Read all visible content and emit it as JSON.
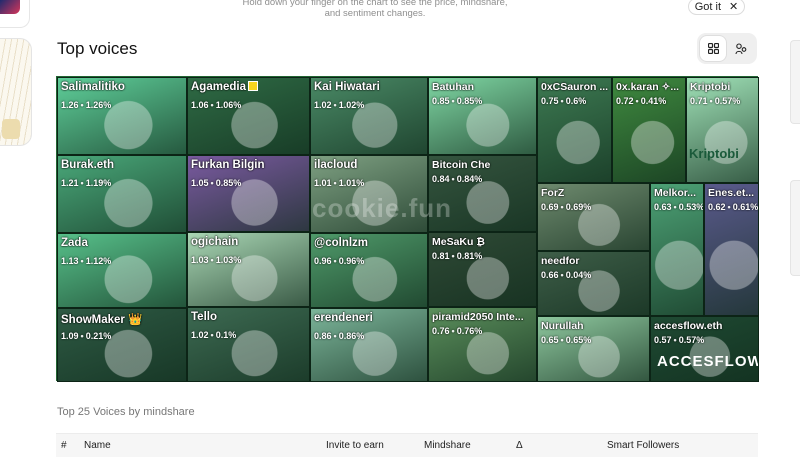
{
  "hint": {
    "line1": "Hold down your finger on the chart to see the price, mindshare,",
    "line2": "and sentiment changes."
  },
  "got_it": {
    "label": "Got it",
    "close_glyph": "✕"
  },
  "section_title": "Top voices",
  "view_toggle": {
    "grid_icon": "grid-icon",
    "people_icon": "people-icon"
  },
  "treemap": {
    "watermark": "cookie.fun",
    "tiles": [
      {
        "name": "Salimalitiko",
        "value": "1.26",
        "change": "1.26%",
        "color": "#5fcf9a"
      },
      {
        "name": "Agamedia",
        "value": "1.06",
        "change": "1.06%",
        "color": "#2f6b45",
        "badge": "yellow-square"
      },
      {
        "name": "Kai Hiwatari",
        "value": "1.02",
        "change": "1.02%",
        "color": "#4a8a66"
      },
      {
        "name": "Batuhan",
        "value": "0.85",
        "change": "0.85%",
        "color": "#7fd6a3"
      },
      {
        "name": "0xCSauron ...",
        "value": "0.75",
        "change": "0.6%",
        "color": "#3d7a52"
      },
      {
        "name": "0x.karan ✧...",
        "value": "0.72",
        "change": "0.41%",
        "color": "#3f8a3f"
      },
      {
        "name": "Kriptobi",
        "value": "0.71",
        "change": "0.57%",
        "color": "#9fe0b6",
        "logo_text": "Kriptobi"
      },
      {
        "name": "Burak.eth",
        "value": "1.21",
        "change": "1.19%",
        "color": "#4aa87a"
      },
      {
        "name": "Furkan Bilgin",
        "value": "1.05",
        "change": "0.85%",
        "color": "#7a5aa0"
      },
      {
        "name": "ilacloud",
        "value": "1.01",
        "change": "1.01%",
        "color": "#7ea082"
      },
      {
        "name": "Bitcoin Che",
        "value": "0.84",
        "change": "0.84%",
        "color": "#35553f"
      },
      {
        "name": "ForZ",
        "value": "0.69",
        "change": "0.69%",
        "color": "#6e8a6e"
      },
      {
        "name": "Melkor...",
        "value": "0.63",
        "change": "0.53%",
        "color": "#4da276"
      },
      {
        "name": "Enes.et...",
        "value": "0.62",
        "change": "0.61%",
        "color": "#5a5a8c"
      },
      {
        "name": "Zada",
        "value": "1.13",
        "change": "1.12%",
        "color": "#57c08a"
      },
      {
        "name": "ogichain",
        "value": "1.03",
        "change": "1.03%",
        "color": "#a9d6b4"
      },
      {
        "name": "@colnlzm",
        "value": "0.96",
        "change": "0.96%",
        "color": "#4f9a6a"
      },
      {
        "name": "MeSaKu ₿",
        "value": "0.81",
        "change": "0.81%",
        "color": "#2f4a36"
      },
      {
        "name": "needfor",
        "value": "0.66",
        "change": "0.04%",
        "color": "#3e5e48"
      },
      {
        "name": "ShowMaker 👑",
        "value": "1.09",
        "change": "0.21%",
        "color": "#2e5a44"
      },
      {
        "name": "Tello",
        "value": "1.02",
        "change": "0.1%",
        "color": "#3d6a52"
      },
      {
        "name": "erendeneri",
        "value": "0.86",
        "change": "0.86%",
        "color": "#7cb59a"
      },
      {
        "name": "piramid2050 Inte...",
        "value": "0.76",
        "change": "0.76%",
        "color": "#5b8f5c"
      },
      {
        "name": "Nurullah",
        "value": "0.65",
        "change": "0.65%",
        "color": "#8ec79e"
      },
      {
        "name": "accesflow.eth",
        "value": "0.57",
        "change": "0.57%",
        "color": "#1f4a33",
        "logo_text": "ACCESFLOW"
      }
    ]
  },
  "table": {
    "caption": "Top 25 Voices by mindshare",
    "columns": [
      "#",
      "Name",
      "Invite to earn",
      "Mindshare",
      "Δ",
      "Smart Followers"
    ]
  }
}
